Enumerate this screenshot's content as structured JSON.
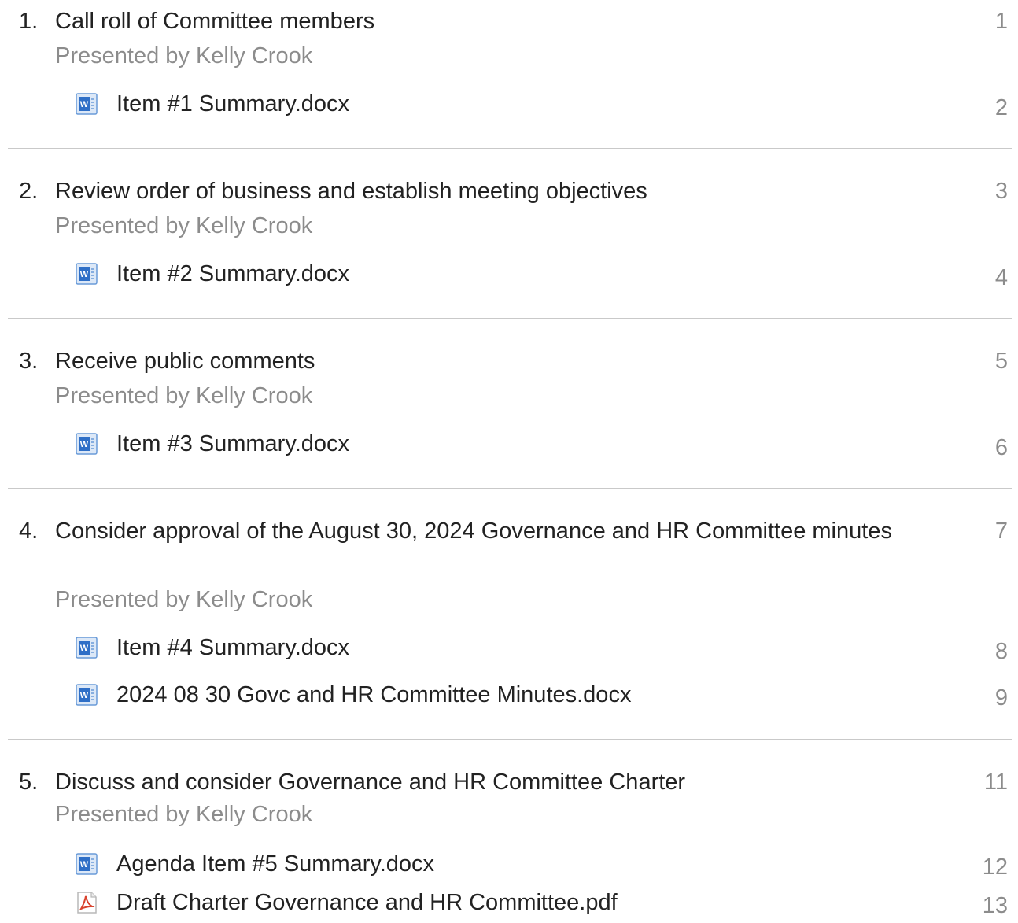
{
  "agenda": {
    "items": [
      {
        "number": "1.",
        "title": "Call roll of Committee members",
        "presenter": "Presented by Kelly Crook",
        "page": "1",
        "attachments": [
          {
            "icon": "word-doc-icon",
            "label": "Item #1 Summary.docx",
            "page": "2"
          }
        ]
      },
      {
        "number": "2.",
        "title": "Review order of business and establish meeting objectives",
        "presenter": "Presented by Kelly Crook",
        "page": "3",
        "attachments": [
          {
            "icon": "word-doc-icon",
            "label": "Item #2 Summary.docx",
            "page": "4"
          }
        ]
      },
      {
        "number": "3.",
        "title": "Receive public comments",
        "presenter": "Presented by Kelly Crook",
        "page": "5",
        "attachments": [
          {
            "icon": "word-doc-icon",
            "label": "Item #3 Summary.docx",
            "page": "6"
          }
        ]
      },
      {
        "number": "4.",
        "title": "Consider approval of the August 30, 2024 Governance and HR Committee minutes",
        "presenter": "Presented by Kelly Crook",
        "page": "7",
        "attachments": [
          {
            "icon": "word-doc-icon",
            "label": "Item #4 Summary.docx",
            "page": "8"
          },
          {
            "icon": "word-doc-icon",
            "label": "2024 08 30 Govc and HR Committee Minutes.docx",
            "page": "9"
          }
        ]
      },
      {
        "number": "5.",
        "title": "Discuss and consider Governance and HR Committee Charter",
        "presenter": "Presented by Kelly Crook",
        "page": "11",
        "attachments": [
          {
            "icon": "word-doc-icon",
            "label": "Agenda Item #5 Summary.docx",
            "page": "12"
          },
          {
            "icon": "pdf-doc-icon",
            "label": "Draft Charter Governance and HR Committee.pdf",
            "page": "13"
          }
        ]
      }
    ]
  },
  "colors": {
    "text": "#222222",
    "muted": "#8c8c8c",
    "divider": "#c9c9c9",
    "word_icon": "#2f6fc7",
    "pdf_icon": "#d9432e"
  }
}
